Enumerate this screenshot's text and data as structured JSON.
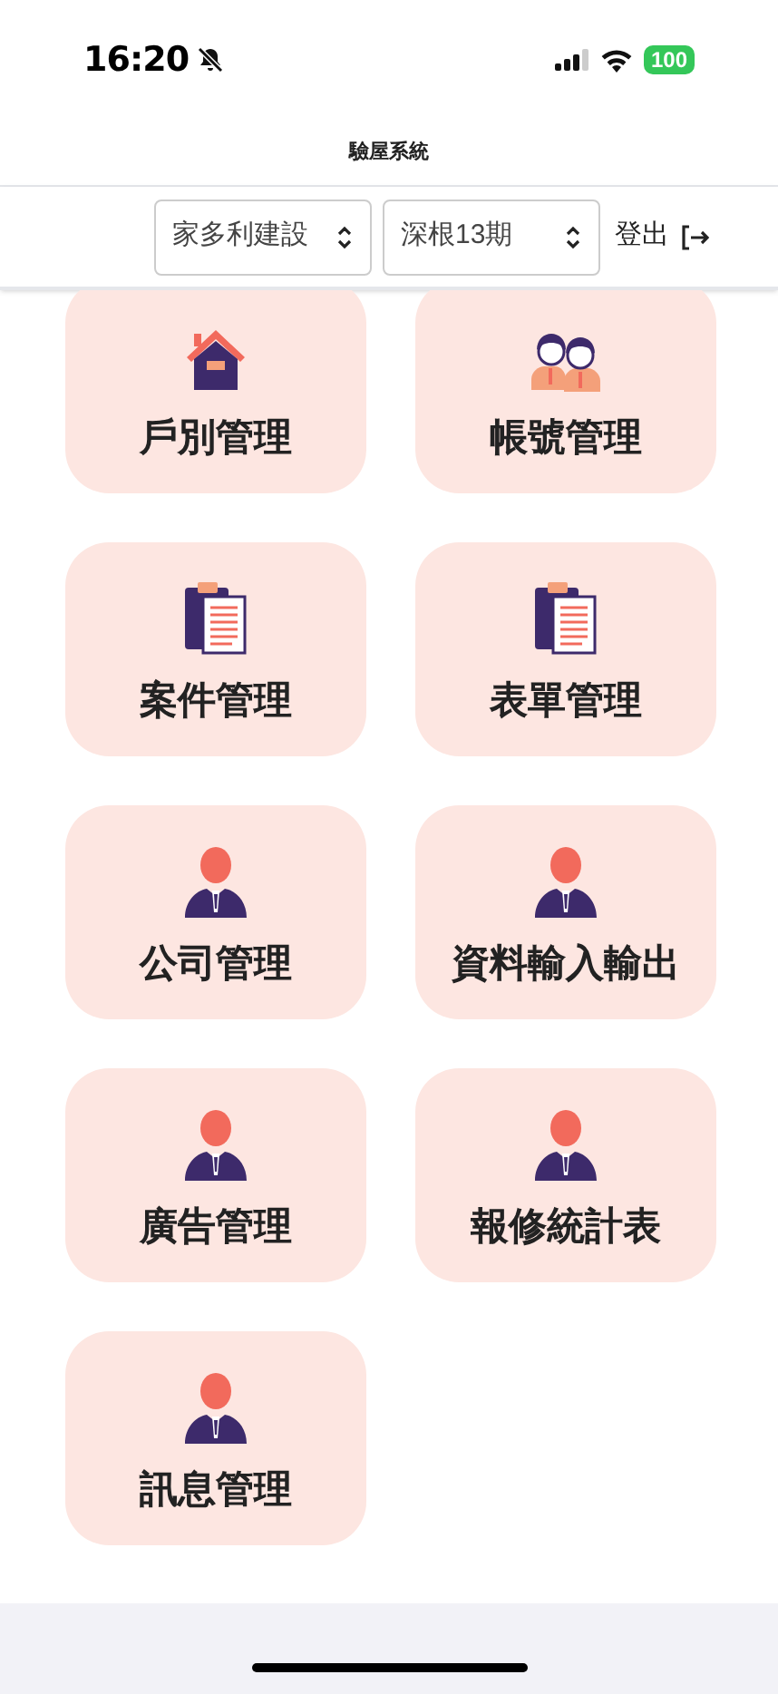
{
  "status_bar": {
    "time": "16:20",
    "battery": "100"
  },
  "title": "驗屋系統",
  "toolbar": {
    "company": "家多利建設",
    "project": "深根13期",
    "logout": "登出"
  },
  "menu": [
    {
      "label": "戶別管理",
      "kind": "house"
    },
    {
      "label": "帳號管理",
      "kind": "people"
    },
    {
      "label": "案件管理",
      "kind": "clipboard"
    },
    {
      "label": "表單管理",
      "kind": "clipboard"
    },
    {
      "label": "公司管理",
      "kind": "person"
    },
    {
      "label": "資料輸入輸出",
      "kind": "person"
    },
    {
      "label": "廣告管理",
      "kind": "person"
    },
    {
      "label": "報修統計表",
      "kind": "person"
    },
    {
      "label": "訊息管理",
      "kind": "person"
    }
  ]
}
